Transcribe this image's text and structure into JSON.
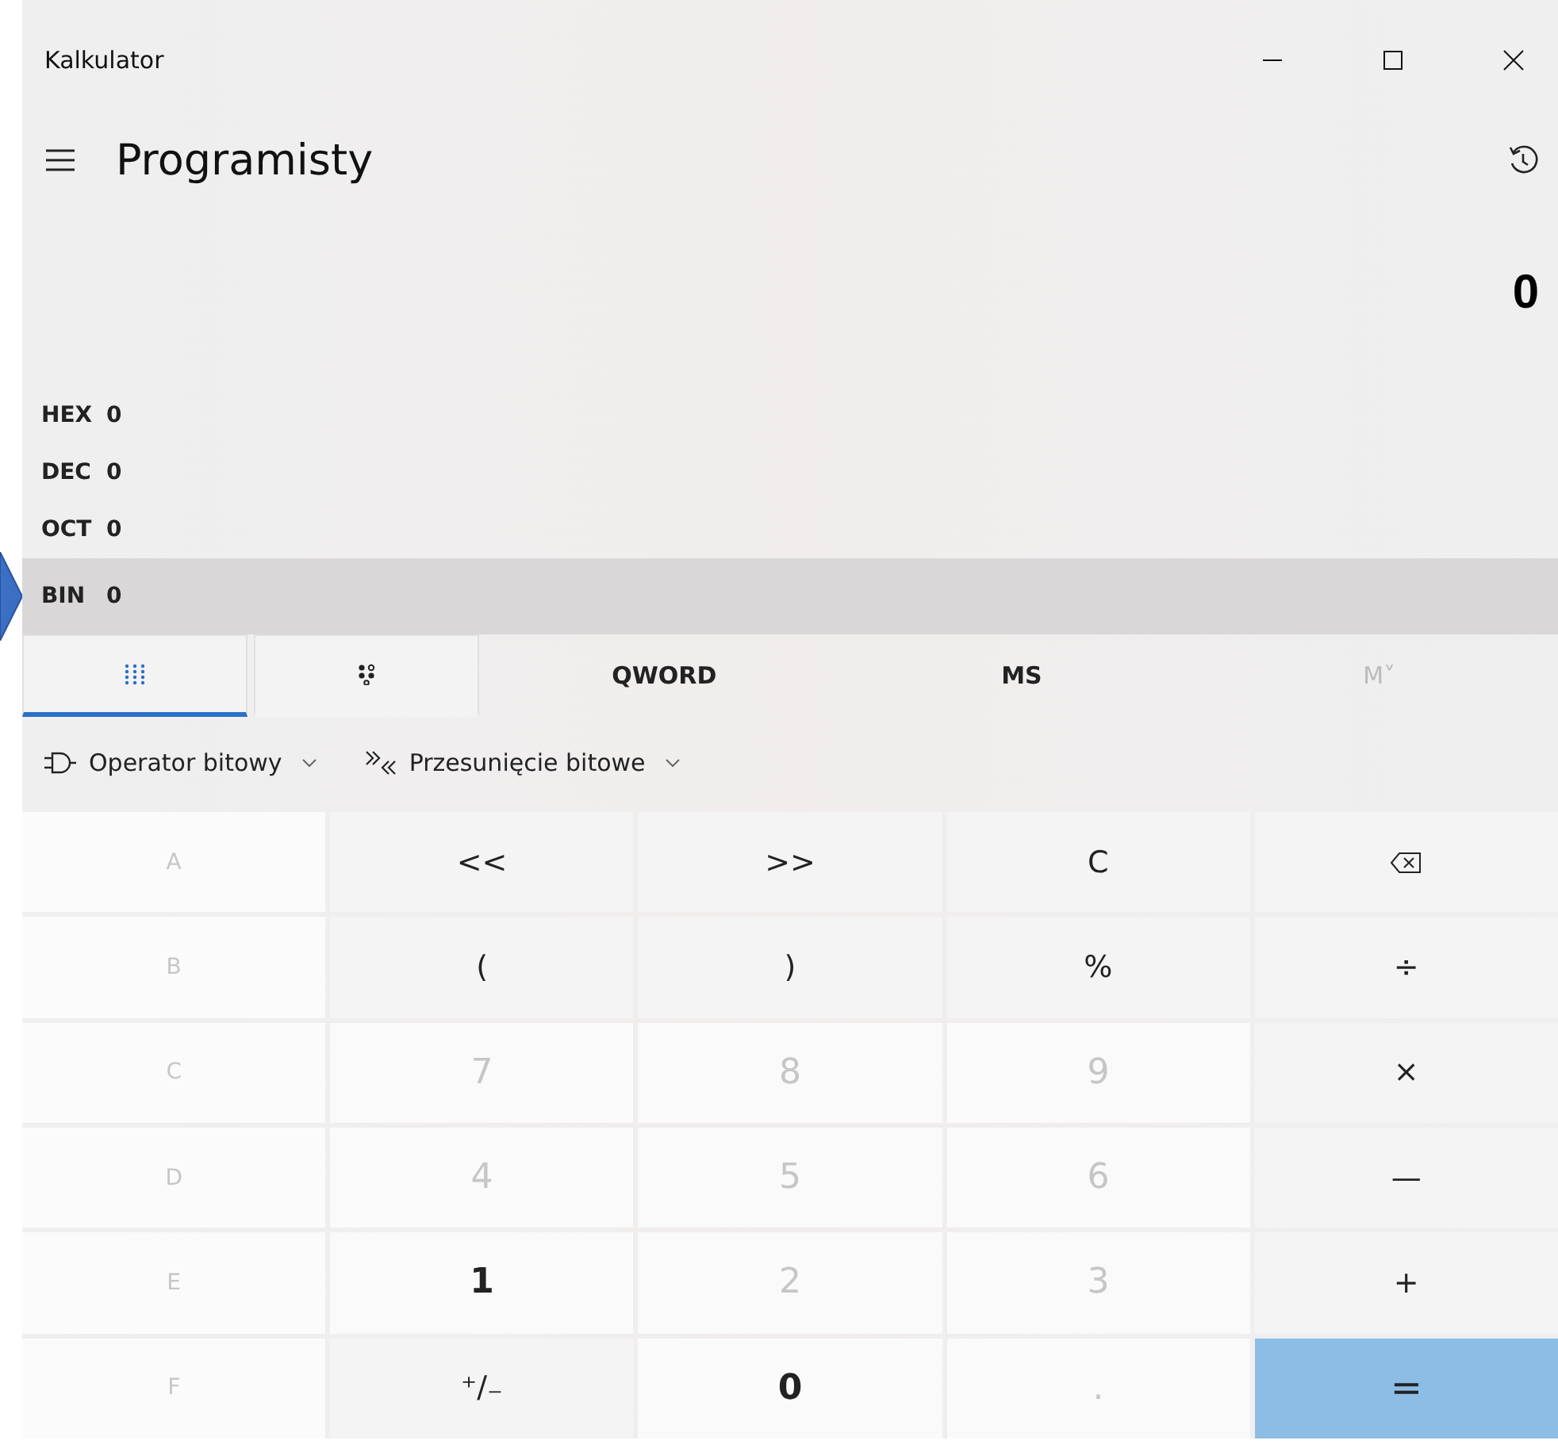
{
  "window": {
    "title": "Kalkulator"
  },
  "header": {
    "title": "Programisty"
  },
  "display": {
    "value": "0"
  },
  "radix": [
    {
      "label": "HEX",
      "value": "0",
      "selected": false
    },
    {
      "label": "DEC",
      "value": "0",
      "selected": false
    },
    {
      "label": "OCT",
      "value": "0",
      "selected": false
    },
    {
      "label": "BIN",
      "value": "0",
      "selected": true
    }
  ],
  "toolbar": [
    {
      "kind": "keypad",
      "selected": true
    },
    {
      "kind": "bits",
      "selected": false
    },
    {
      "kind": "text",
      "label": "QWORD",
      "disabled": false
    },
    {
      "kind": "text",
      "label": "MS",
      "disabled": false
    },
    {
      "kind": "text",
      "label": "M˅",
      "disabled": true
    }
  ],
  "menus": [
    {
      "kind": "gate",
      "label": "Operator bitowy"
    },
    {
      "kind": "shift",
      "label": "Przesunięcie bitowe"
    }
  ],
  "keys": [
    [
      {
        "kind": "hex",
        "label": "A",
        "disabled": true
      },
      {
        "kind": "op",
        "label": "<<",
        "disabled": false
      },
      {
        "kind": "op",
        "label": ">>",
        "disabled": false
      },
      {
        "kind": "op",
        "label": "C",
        "disabled": false
      },
      {
        "kind": "backspace",
        "disabled": false
      }
    ],
    [
      {
        "kind": "hex",
        "label": "B",
        "disabled": true
      },
      {
        "kind": "op",
        "label": "(",
        "disabled": false
      },
      {
        "kind": "op",
        "label": ")",
        "disabled": false
      },
      {
        "kind": "op",
        "label": "%",
        "disabled": false
      },
      {
        "kind": "op",
        "label": "÷",
        "disabled": false
      }
    ],
    [
      {
        "kind": "hex",
        "label": "C",
        "disabled": true
      },
      {
        "kind": "digit",
        "label": "7",
        "disabled": true
      },
      {
        "kind": "digit",
        "label": "8",
        "disabled": true
      },
      {
        "kind": "digit",
        "label": "9",
        "disabled": true
      },
      {
        "kind": "op",
        "label": "×",
        "disabled": false
      }
    ],
    [
      {
        "kind": "hex",
        "label": "D",
        "disabled": true
      },
      {
        "kind": "digit",
        "label": "4",
        "disabled": true
      },
      {
        "kind": "digit",
        "label": "5",
        "disabled": true
      },
      {
        "kind": "digit",
        "label": "6",
        "disabled": true
      },
      {
        "kind": "op",
        "label": "—",
        "disabled": false
      }
    ],
    [
      {
        "kind": "hex",
        "label": "E",
        "disabled": true
      },
      {
        "kind": "digit",
        "label": "1",
        "disabled": false
      },
      {
        "kind": "digit",
        "label": "2",
        "disabled": true
      },
      {
        "kind": "digit",
        "label": "3",
        "disabled": true
      },
      {
        "kind": "op",
        "label": "+",
        "disabled": false
      }
    ],
    [
      {
        "kind": "hex",
        "label": "F",
        "disabled": true
      },
      {
        "kind": "op",
        "label": "⁺∕₋",
        "disabled": false
      },
      {
        "kind": "digit",
        "label": "0",
        "disabled": false
      },
      {
        "kind": "digit",
        "label": ".",
        "disabled": true
      },
      {
        "kind": "equals",
        "label": "=",
        "disabled": false
      }
    ]
  ]
}
